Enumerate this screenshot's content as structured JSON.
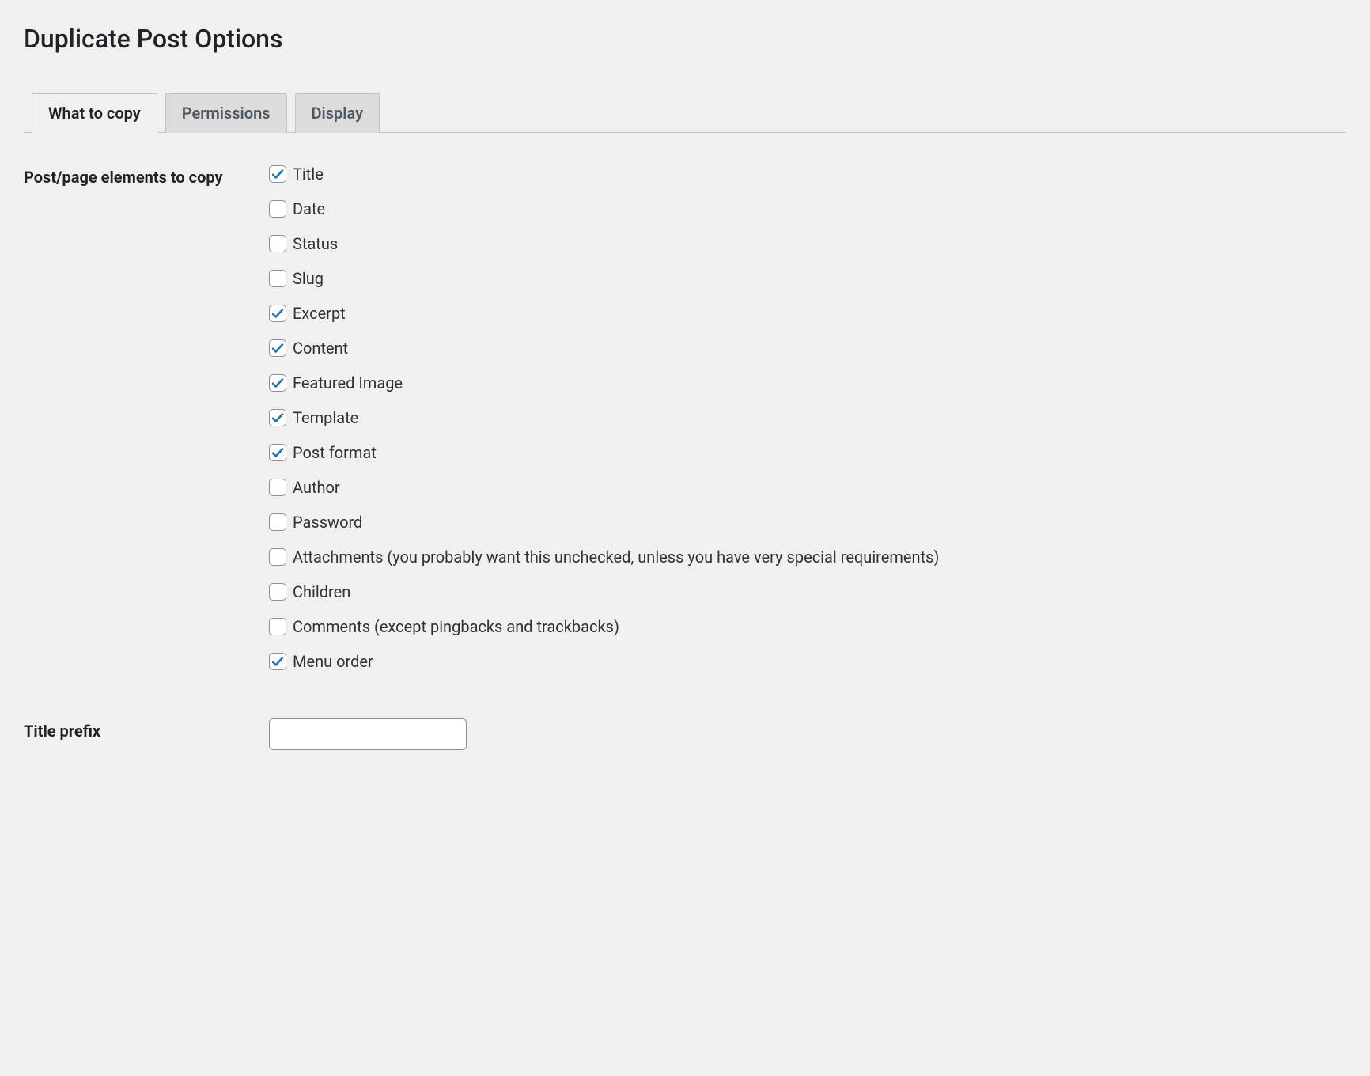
{
  "page": {
    "title": "Duplicate Post Options"
  },
  "tabs": [
    {
      "label": "What to copy"
    },
    {
      "label": "Permissions"
    },
    {
      "label": "Display"
    }
  ],
  "section": {
    "elements_heading": "Post/page elements to copy",
    "title_prefix_heading": "Title prefix"
  },
  "elements": [
    {
      "label": "Title",
      "checked": true
    },
    {
      "label": "Date",
      "checked": false
    },
    {
      "label": "Status",
      "checked": false
    },
    {
      "label": "Slug",
      "checked": false
    },
    {
      "label": "Excerpt",
      "checked": true
    },
    {
      "label": "Content",
      "checked": true
    },
    {
      "label": "Featured Image",
      "checked": true
    },
    {
      "label": "Template",
      "checked": true
    },
    {
      "label": "Post format",
      "checked": true
    },
    {
      "label": "Author",
      "checked": false
    },
    {
      "label": "Password",
      "checked": false
    },
    {
      "label": "Attachments (you probably want this unchecked, unless you have very special requirements)",
      "checked": false
    },
    {
      "label": "Children",
      "checked": false
    },
    {
      "label": "Comments (except pingbacks and trackbacks)",
      "checked": false
    },
    {
      "label": "Menu order",
      "checked": true
    }
  ],
  "title_prefix_value": ""
}
